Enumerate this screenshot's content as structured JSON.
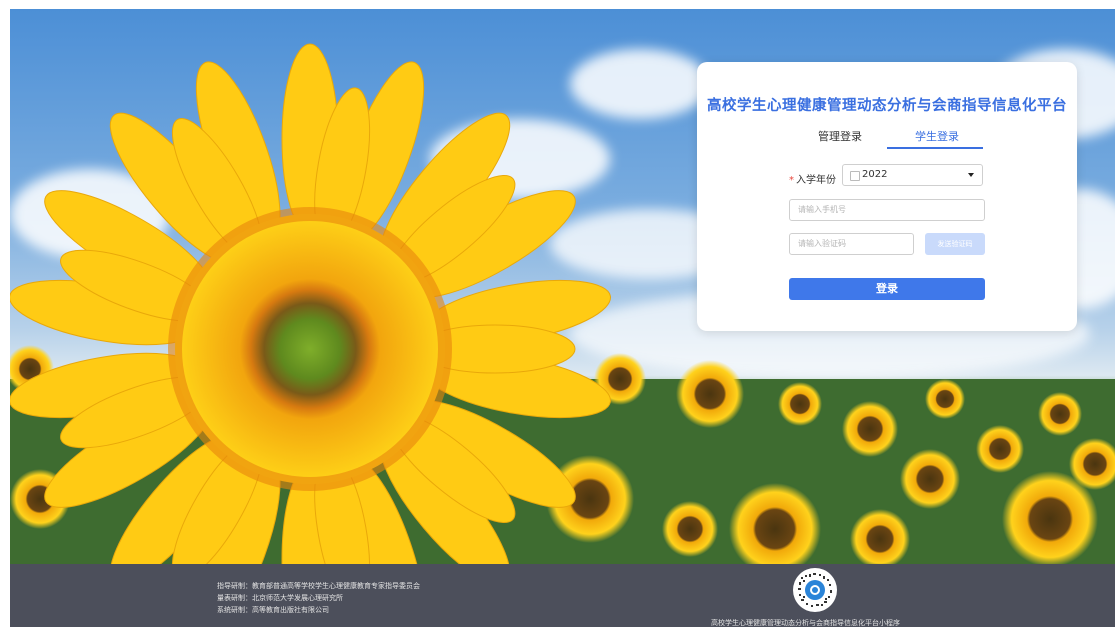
{
  "card": {
    "title": "高校学生心理健康管理动态分析与会商指导信息化平台",
    "tabs": [
      {
        "label": "管理登录",
        "active": false
      },
      {
        "label": "学生登录",
        "active": true
      }
    ],
    "enroll_year_label": "入学年份",
    "enroll_year_required_mark": "*",
    "enroll_year_value": "2022",
    "phone_placeholder": "请输入手机号",
    "code_placeholder": "请输入验证码",
    "get_code_label": "发送验证码",
    "login_label": "登录",
    "accent_color": "#3a6fe0"
  },
  "footer": {
    "credits": [
      "指导研制：教育部普通高等学校学生心理健康教育专家指导委员会",
      "量表研制：北京师范大学发展心理研究所",
      "系统研制：高等教育出版社有限公司"
    ],
    "qr_caption": "高校学生心理健康管理动态分析与会商指导信息化平台小程序",
    "background_color": "#4c4f5b"
  },
  "background": {
    "description_icon": "sunflower-field-image"
  }
}
